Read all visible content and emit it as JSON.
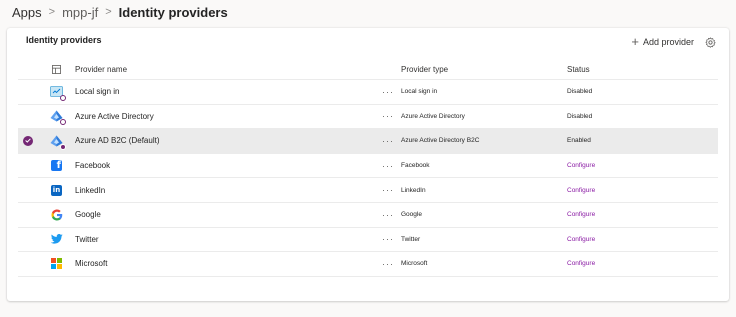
{
  "breadcrumb": {
    "apps": "Apps",
    "environment": "mpp-jf",
    "current": "Identity providers",
    "separator": ">"
  },
  "card": {
    "title": "Identity providers",
    "add_label": "Add provider",
    "add_icon": "+"
  },
  "table": {
    "headers": {
      "name": "Provider name",
      "type": "Provider type",
      "status": "Status"
    },
    "more_label": "···",
    "rows": [
      {
        "name": "Local sign in",
        "type": "Local sign in",
        "status": "Disabled",
        "icon": "local-signin-icon",
        "selected": false
      },
      {
        "name": "Azure Active Directory",
        "type": "Azure Active Directory",
        "status": "Disabled",
        "icon": "azure-ad-icon",
        "selected": false
      },
      {
        "name": "Azure AD B2C (Default)",
        "type": "Azure Active Directory B2C",
        "status": "Enabled",
        "icon": "azure-ad-b2c-icon",
        "selected": true
      },
      {
        "name": "Facebook",
        "type": "Facebook",
        "status": "Configure",
        "icon": "facebook-icon",
        "selected": false
      },
      {
        "name": "LinkedIn",
        "type": "LinkedIn",
        "status": "Configure",
        "icon": "linkedin-icon",
        "selected": false
      },
      {
        "name": "Google",
        "type": "Google",
        "status": "Configure",
        "icon": "google-icon",
        "selected": false
      },
      {
        "name": "Twitter",
        "type": "Twitter",
        "status": "Configure",
        "icon": "twitter-icon",
        "selected": false
      },
      {
        "name": "Microsoft",
        "type": "Microsoft",
        "status": "Configure",
        "icon": "microsoft-icon",
        "selected": false
      }
    ]
  },
  "colors": {
    "accent": "#742774",
    "link": "#8a1ba4",
    "selected_row": "#ebebeb"
  }
}
